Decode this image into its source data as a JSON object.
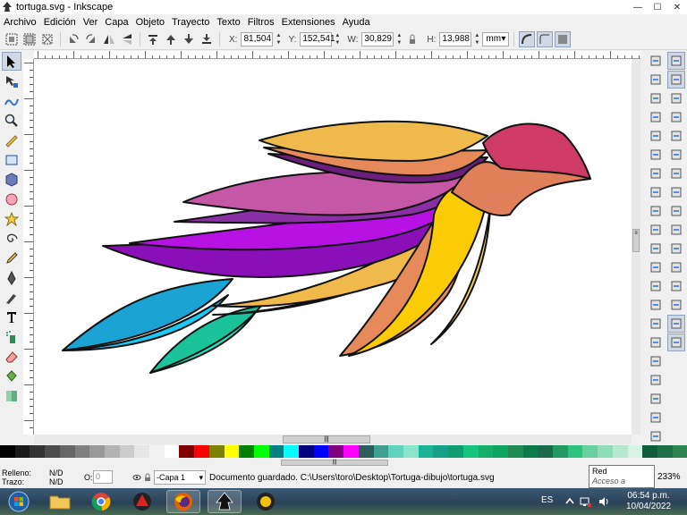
{
  "window": {
    "title": "tortuga.svg - Inkscape",
    "controls": {
      "minimize": "—",
      "maximize": "☐",
      "close": "✕"
    }
  },
  "menu": [
    "Archivo",
    "Edición",
    "Ver",
    "Capa",
    "Objeto",
    "Trayecto",
    "Texto",
    "Filtros",
    "Extensiones",
    "Ayuda"
  ],
  "tool_controls": {
    "x_label": "X:",
    "x_value": "81,504",
    "y_label": "Y:",
    "y_value": "152,541",
    "w_label": "W:",
    "w_value": "30,829",
    "h_label": "H:",
    "h_value": "13,988",
    "unit": "mm"
  },
  "left_tools": [
    "selector-icon",
    "node-icon",
    "tweak-icon",
    "zoom-icon",
    "measure-icon",
    "rectangle-icon",
    "3d-box-icon",
    "ellipse-icon",
    "star-icon",
    "spiral-icon",
    "pencil-icon",
    "pen-icon",
    "calligraphy-icon",
    "text-icon",
    "spray-icon",
    "eraser-icon",
    "bucket-icon",
    "gradient-icon"
  ],
  "commands": [
    "new-document-icon",
    "open-icon",
    "save-icon",
    "print-icon",
    "import-icon",
    "export-icon",
    "undo-icon",
    "redo-icon",
    "copy-icon",
    "cut-icon",
    "paste-icon",
    "zoom-selection-icon",
    "zoom-drawing-icon",
    "zoom-page-icon",
    "duplicate-icon",
    "clone-icon",
    "unlink-clone-icon",
    "group-icon",
    "ungroup-icon",
    "fill-stroke-icon",
    "text-font-icon",
    "xml-editor-icon",
    "align-icon"
  ],
  "snap": [
    "snap-toggle-icon",
    "snap-bbox-icon",
    "snap-bbox-edge-icon",
    "snap-bbox-corner-icon",
    "snap-nodes-icon",
    "snap-path-icon",
    "snap-intersection-icon",
    "snap-cusp-icon",
    "snap-smooth-icon",
    "snap-midpoint-icon",
    "snap-center-icon",
    "snap-rotation-icon",
    "snap-text-baseline-icon",
    "snap-page-icon",
    "snap-grid-icon",
    "snap-guide-icon"
  ],
  "status": {
    "fill_label": "Relleno:",
    "fill_value": "N/D",
    "stroke_label": "Trazo:",
    "stroke_value": "N/D",
    "opacity_label": "O:",
    "opacity_value": "0",
    "layer": "-Capa 1",
    "message": "Documento guardado. C:\\Users\\toro\\Desktop\\Tortuga-dibujo\\tortuga.svg",
    "zoom": "233%"
  },
  "tooltip": {
    "title": "Red",
    "subtitle": "Acceso a Internet"
  },
  "taskbar": {
    "apps": [
      "start-orb",
      "explorer-icon",
      "chrome-icon",
      "app-red-icon",
      "firefox-icon",
      "inkscape-icon",
      "app-yellow-icon"
    ],
    "language": "ES",
    "time": "06:54 p.m.",
    "date": "10/04/2022"
  },
  "palette_colors": [
    "#000000",
    "#1a1a1a",
    "#333333",
    "#4d4d4d",
    "#666666",
    "#808080",
    "#999999",
    "#b3b3b3",
    "#cccccc",
    "#e6e6e6",
    "#f2f2f2",
    "#ffffff",
    "#800000",
    "#ff0000",
    "#808000",
    "#ffff00",
    "#008000",
    "#00ff00",
    "#008080",
    "#00ffff",
    "#000080",
    "#0000ff",
    "#800080",
    "#ff00ff",
    "#2b5f5a",
    "#3fa08f",
    "#5fd3bc",
    "#88e5cc",
    "#1ab394",
    "#16a085",
    "#0e9e72",
    "#18c37f",
    "#14ad6a",
    "#0ea363",
    "#1f8a53",
    "#0d7a4c",
    "#1a6b4b",
    "#219a63",
    "#2ec27e",
    "#6ad0a0",
    "#8fdcb8",
    "#b5e8cf",
    "#d7f3e5",
    "#0f5d3a",
    "#1e7146",
    "#2e8553"
  ],
  "turtle_colors": {
    "body_top": "#efb94c",
    "head": "#cf3a66",
    "neck": "#e0805a",
    "purple_dark": "#6a1f7a",
    "purple": "#c558a6",
    "violet": "#8b2fa7",
    "bright_purple": "#b711e3",
    "deep_purple": "#8a0fb8",
    "blue": "#1aa3d3",
    "cyan": "#1cc9f5",
    "aqua": "#22e6c6",
    "teal": "#1bc39a",
    "orange": "#e68a5a",
    "yellow": "#fbcc06",
    "light_yellow": "#fad054"
  }
}
